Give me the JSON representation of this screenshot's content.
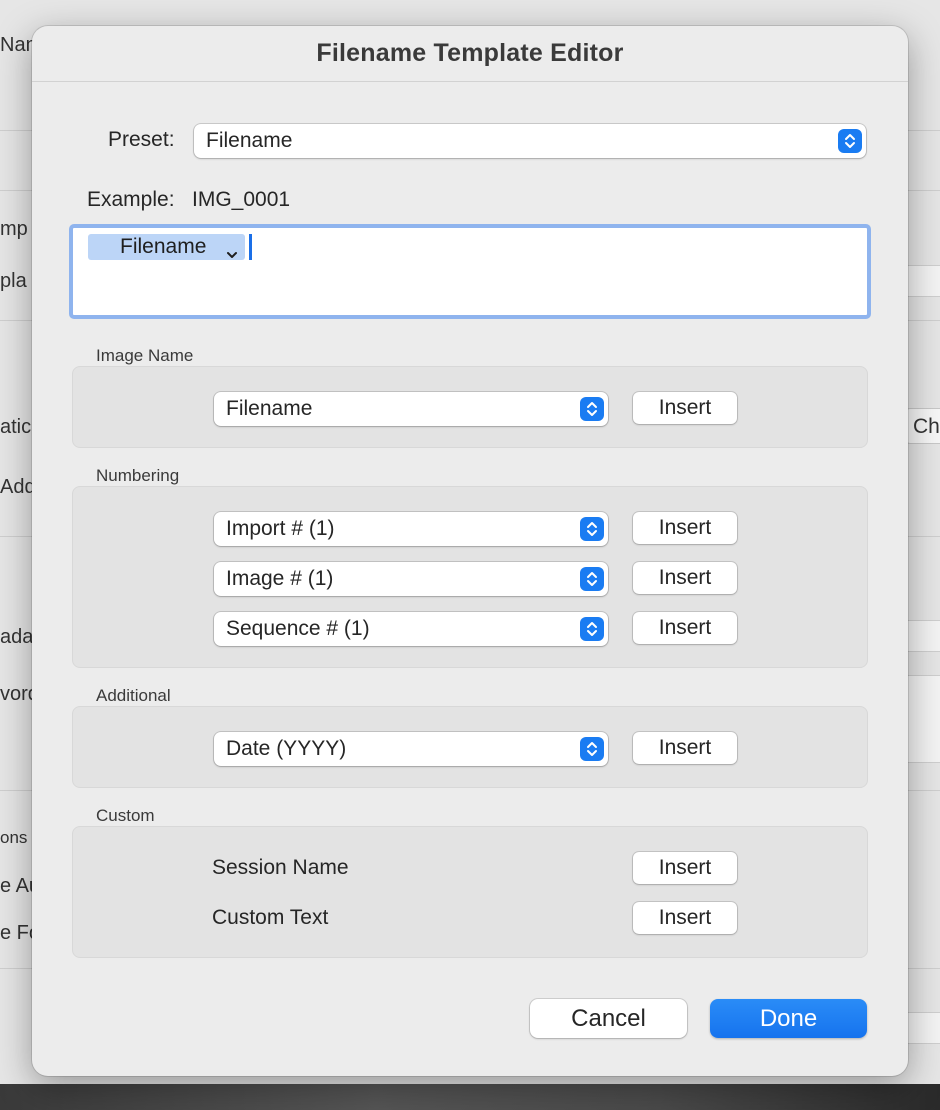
{
  "background": {
    "labels": [
      "Nam",
      "mp",
      "pla",
      "atic",
      "Add",
      "ada",
      "vord",
      "ons",
      "e Au",
      "e Fo"
    ],
    "button_label": "Ch"
  },
  "dialog": {
    "title": "Filename Template Editor",
    "preset": {
      "label": "Preset:",
      "value": "Filename"
    },
    "example": {
      "label": "Example:",
      "value": "IMG_0001"
    },
    "template": {
      "token_label": "Filename"
    },
    "sections": {
      "image_name": {
        "label": "Image Name",
        "popup_value": "Filename",
        "insert_label": "Insert"
      },
      "numbering": {
        "label": "Numbering",
        "rows": [
          {
            "popup_value": "Import # (1)",
            "insert_label": "Insert"
          },
          {
            "popup_value": "Image # (1)",
            "insert_label": "Insert"
          },
          {
            "popup_value": "Sequence # (1)",
            "insert_label": "Insert"
          }
        ]
      },
      "additional": {
        "label": "Additional",
        "popup_value": "Date (YYYY)",
        "insert_label": "Insert"
      },
      "custom": {
        "label": "Custom",
        "rows": [
          {
            "label": "Session Name",
            "insert_label": "Insert"
          },
          {
            "label": "Custom Text",
            "insert_label": "Insert"
          }
        ]
      }
    },
    "buttons": {
      "cancel": "Cancel",
      "done": "Done"
    }
  },
  "colors": {
    "accent": "#1a7cf2",
    "token_bg": "#bcd5f7",
    "focus_ring": "#8fb4ee",
    "dialog_bg": "#ececec",
    "section_bg": "#e3e3e3"
  },
  "icons": {
    "stepper": "up-down-chevron-icon",
    "token_menu": "chevron-down-icon"
  }
}
